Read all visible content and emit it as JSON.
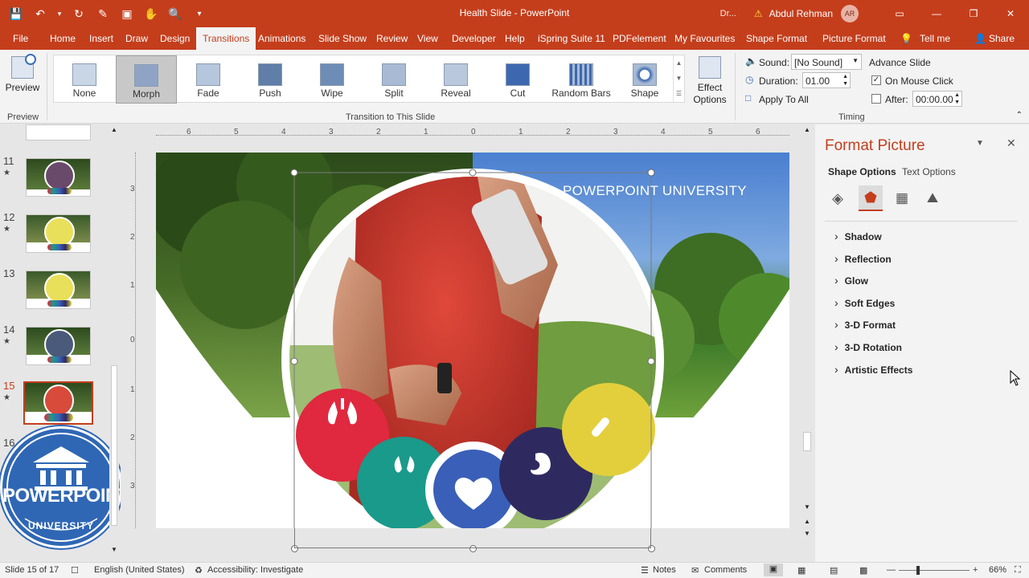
{
  "app": {
    "doc_title": "Health Slide - PowerPoint",
    "draft_label": "Dr...",
    "user_name": "Abdul Rehman",
    "user_initials": "AR"
  },
  "tabs": [
    "File",
    "Home",
    "Insert",
    "Draw",
    "Design",
    "Transitions",
    "Animations",
    "Slide Show",
    "Review",
    "View",
    "Developer",
    "Help",
    "iSpring Suite 11",
    "PDFelement",
    "My Favourites",
    "Shape Format",
    "Picture Format",
    "Tell me",
    "Share"
  ],
  "ribbon": {
    "preview_label": "Preview",
    "preview_group": "Preview",
    "transitions": [
      "None",
      "Morph",
      "Fade",
      "Push",
      "Wipe",
      "Split",
      "Reveal",
      "Cut",
      "Random Bars",
      "Shape"
    ],
    "selected_transition": "Morph",
    "effect_options": "Effect Options",
    "transition_group": "Transition to This Slide",
    "sound_label": "Sound:",
    "sound_value": "[No Sound]",
    "duration_label": "Duration:",
    "duration_value": "01.00",
    "apply_all": "Apply To All",
    "advance_label": "Advance Slide",
    "on_mouse_click": "On Mouse Click",
    "after_label": "After:",
    "after_value": "00:00.00",
    "timing_group": "Timing"
  },
  "thumbnails": {
    "numbers": [
      "11",
      "12",
      "13",
      "14",
      "15",
      "16"
    ],
    "current": "15"
  },
  "slide": {
    "heading": "POWERPOINT UNIVERSITY"
  },
  "ruler": {
    "h_ticks": [
      "6",
      "5",
      "4",
      "3",
      "2",
      "1",
      "0",
      "1",
      "2",
      "3",
      "4",
      "5",
      "6"
    ],
    "v_ticks": [
      "3",
      "2",
      "1",
      "0",
      "1",
      "2",
      "3"
    ]
  },
  "logo": {
    "line1": "POWERPOINT",
    "line2": "UNIVERSITY"
  },
  "format_pane": {
    "title": "Format Picture",
    "tab_shape": "Shape Options",
    "tab_text": "Text Options",
    "sections": [
      "Shadow",
      "Reflection",
      "Glow",
      "Soft Edges",
      "3-D Format",
      "3-D Rotation",
      "Artistic Effects"
    ]
  },
  "status": {
    "slide_info": "Slide 15 of 17",
    "language": "English (United States)",
    "accessibility": "Accessibility: Investigate",
    "notes": "Notes",
    "comments": "Comments",
    "zoom": "66%"
  },
  "colors": {
    "brand": "#c43e1c",
    "circle_red": "#e0283f",
    "circle_teal": "#1a9a8a",
    "circle_blue": "#3a5fb8",
    "circle_navy": "#2e2a60",
    "circle_yellow": "#e3cf3c"
  }
}
